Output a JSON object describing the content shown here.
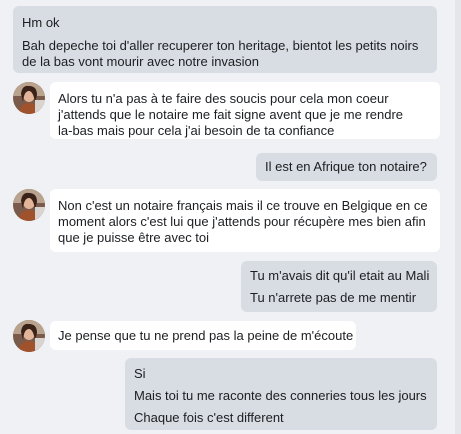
{
  "messages": [
    {
      "direction": "sent",
      "lines": [
        "Hm ok"
      ],
      "extra_lines": [
        "Bah depeche toi d'aller recuperer ton heritage, bientot les petits noirs",
        "de la bas vont mourir avec notre invasion"
      ]
    },
    {
      "direction": "received",
      "lines": [
        "Alors tu n'a pas à te faire des soucis pour cela mon coeur",
        "j'attends que le notaire me fait signe avent que je me rendre",
        "la-bas mais pour cela j'ai besoin de ta confiance"
      ]
    },
    {
      "direction": "sent",
      "lines": [
        "Il est en Afrique ton notaire?"
      ]
    },
    {
      "direction": "received",
      "lines": [
        "Non c'est un notaire français mais il ce trouve en Belgique en ce",
        "moment alors c'est lui que j'attends pour récupère mes bien afin",
        "que je puisse être avec toi"
      ]
    },
    {
      "direction": "sent",
      "lines": [
        "Tu m'avais dit qu'il etait au Mali",
        "Tu n'arrete pas de me mentir"
      ]
    },
    {
      "direction": "received",
      "lines": [
        "Je pense que tu ne prend pas la peine de m'écoute"
      ]
    },
    {
      "direction": "sent",
      "lines": [
        "Si",
        "Mais toi tu me raconte des conneries tous les jours",
        "Chaque fois c'est different"
      ]
    }
  ],
  "colors": {
    "background": "#eff1f4",
    "sent_bubble": "#d8dde3",
    "received_bubble": "#ffffff",
    "text": "#1c1e21"
  },
  "icons": {
    "avatar": "contact-avatar-photo"
  }
}
